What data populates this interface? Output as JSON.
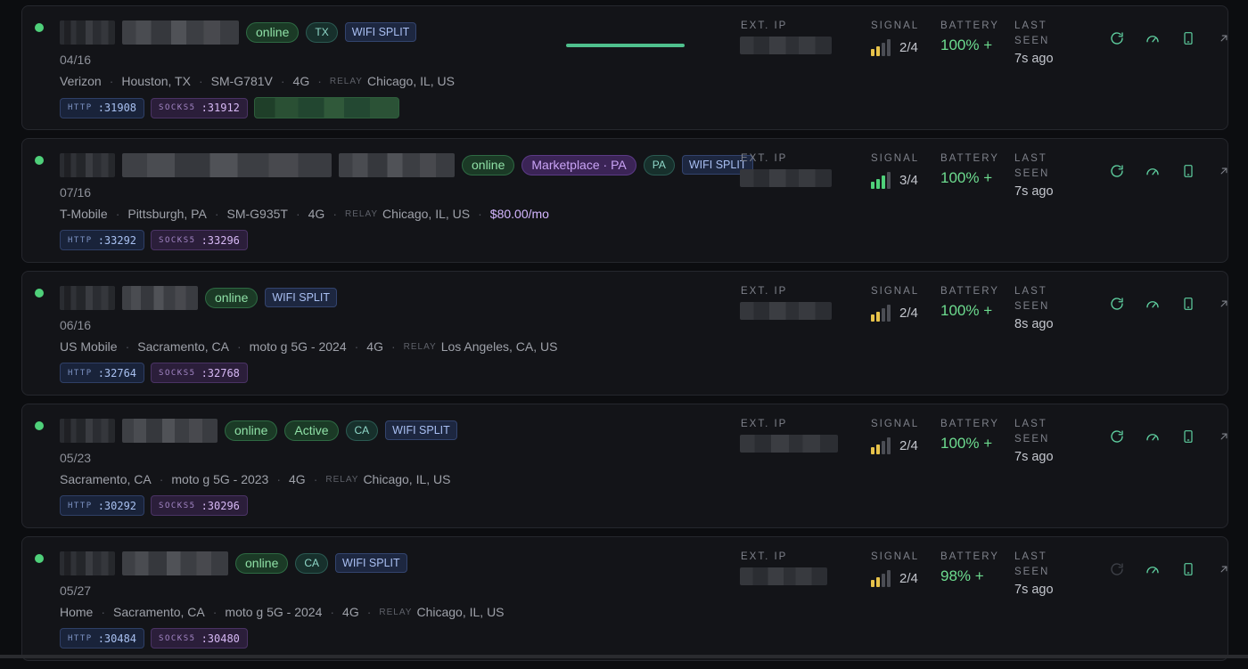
{
  "labels": {
    "ext_ip": "EXT. IP",
    "signal": "SIGNAL",
    "battery": "BATTERY",
    "last_seen": "LAST SEEN",
    "relay": "RELAY",
    "http": "HTTP",
    "socks": "SOCKS5"
  },
  "icons": [
    "refresh-icon",
    "speed-gauge-icon",
    "phone-icon",
    "open-external-icon"
  ],
  "colors": {
    "online": "#4fd07a",
    "signal_bar": "#e7c24a",
    "battery": "#6ddc8f",
    "accent": "#5fd0a0"
  },
  "devices": [
    {
      "badges": [
        {
          "text": "online",
          "kind": "online"
        },
        {
          "text": "TX",
          "kind": "state"
        },
        {
          "text": "WIFI SPLIT",
          "kind": "wifi"
        }
      ],
      "date": "04/16",
      "meta": [
        "Verizon",
        "Houston, TX",
        "SM-G781V",
        "4G"
      ],
      "relay": "Chicago, IL, US",
      "price": "",
      "http_port": ":31908",
      "socks_port": ":31912",
      "has_progress": true,
      "progress": 1.0,
      "signal": "2/4",
      "signal_level": 2,
      "battery": "100% +",
      "last_seen": "7s ago"
    },
    {
      "badges": [
        {
          "text": "online",
          "kind": "online"
        },
        {
          "text": "Marketplace · PA",
          "kind": "market"
        },
        {
          "text": "PA",
          "kind": "state"
        },
        {
          "text": "WIFI SPLIT",
          "kind": "wifi"
        }
      ],
      "date": "07/16",
      "meta": [
        "T-Mobile",
        "Pittsburgh, PA",
        "SM-G935T",
        "4G"
      ],
      "relay": "Chicago, IL, US",
      "price": "$80.00/mo",
      "http_port": ":33292",
      "socks_port": ":33296",
      "has_progress": false,
      "signal": "3/4",
      "signal_level": 3,
      "battery": "100% +",
      "last_seen": "7s ago"
    },
    {
      "badges": [
        {
          "text": "online",
          "kind": "online"
        },
        {
          "text": "WIFI SPLIT",
          "kind": "wifi"
        }
      ],
      "date": "06/16",
      "meta": [
        "US Mobile",
        "Sacramento, CA",
        "moto g 5G - 2024",
        "4G"
      ],
      "relay": "Los Angeles, CA, US",
      "price": "",
      "http_port": ":32764",
      "socks_port": ":32768",
      "has_progress": false,
      "signal": "2/4",
      "signal_level": 2,
      "battery": "100% +",
      "last_seen": "8s ago"
    },
    {
      "badges": [
        {
          "text": "online",
          "kind": "online"
        },
        {
          "text": "Active",
          "kind": "active"
        },
        {
          "text": "CA",
          "kind": "state"
        },
        {
          "text": "WIFI SPLIT",
          "kind": "wifi"
        }
      ],
      "date": "05/23",
      "meta": [
        "Sacramento, CA",
        "moto g 5G - 2023",
        "4G"
      ],
      "relay": "Chicago, IL, US",
      "price": "",
      "http_port": ":30292",
      "socks_port": ":30296",
      "has_progress": false,
      "signal": "2/4",
      "signal_level": 2,
      "battery": "100% +",
      "last_seen": "7s ago"
    },
    {
      "badges": [
        {
          "text": "online",
          "kind": "online"
        },
        {
          "text": "CA",
          "kind": "state"
        },
        {
          "text": "WIFI SPLIT",
          "kind": "wifi"
        }
      ],
      "date": "05/27",
      "meta": [
        "Home",
        "Sacramento, CA",
        "moto g 5G - 2024",
        "4G"
      ],
      "relay": "Chicago, IL, US",
      "price": "",
      "http_port": ":30484",
      "socks_port": ":30480",
      "has_progress": false,
      "signal": "2/4",
      "signal_level": 2,
      "battery": "98% +",
      "last_seen": "7s ago",
      "refresh_disabled": true
    }
  ]
}
